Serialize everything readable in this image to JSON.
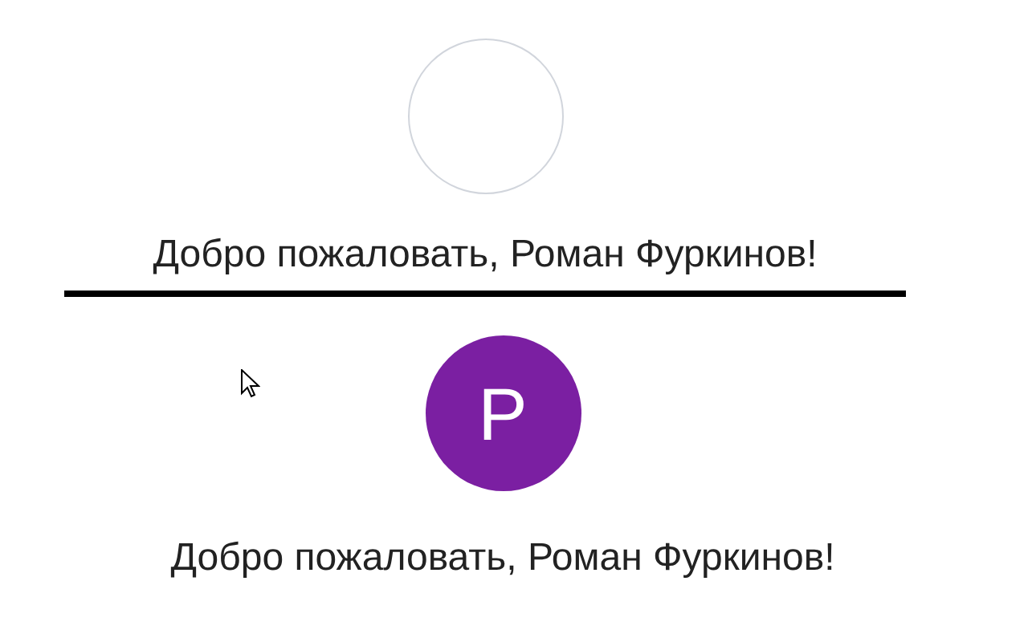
{
  "profiles": [
    {
      "kind": "empty",
      "greeting": "Добро пожаловать, Роман Фуркинов!"
    },
    {
      "kind": "initial",
      "initial": "Р",
      "greeting": "Добро пожаловать, Роман Фуркинов!"
    }
  ]
}
